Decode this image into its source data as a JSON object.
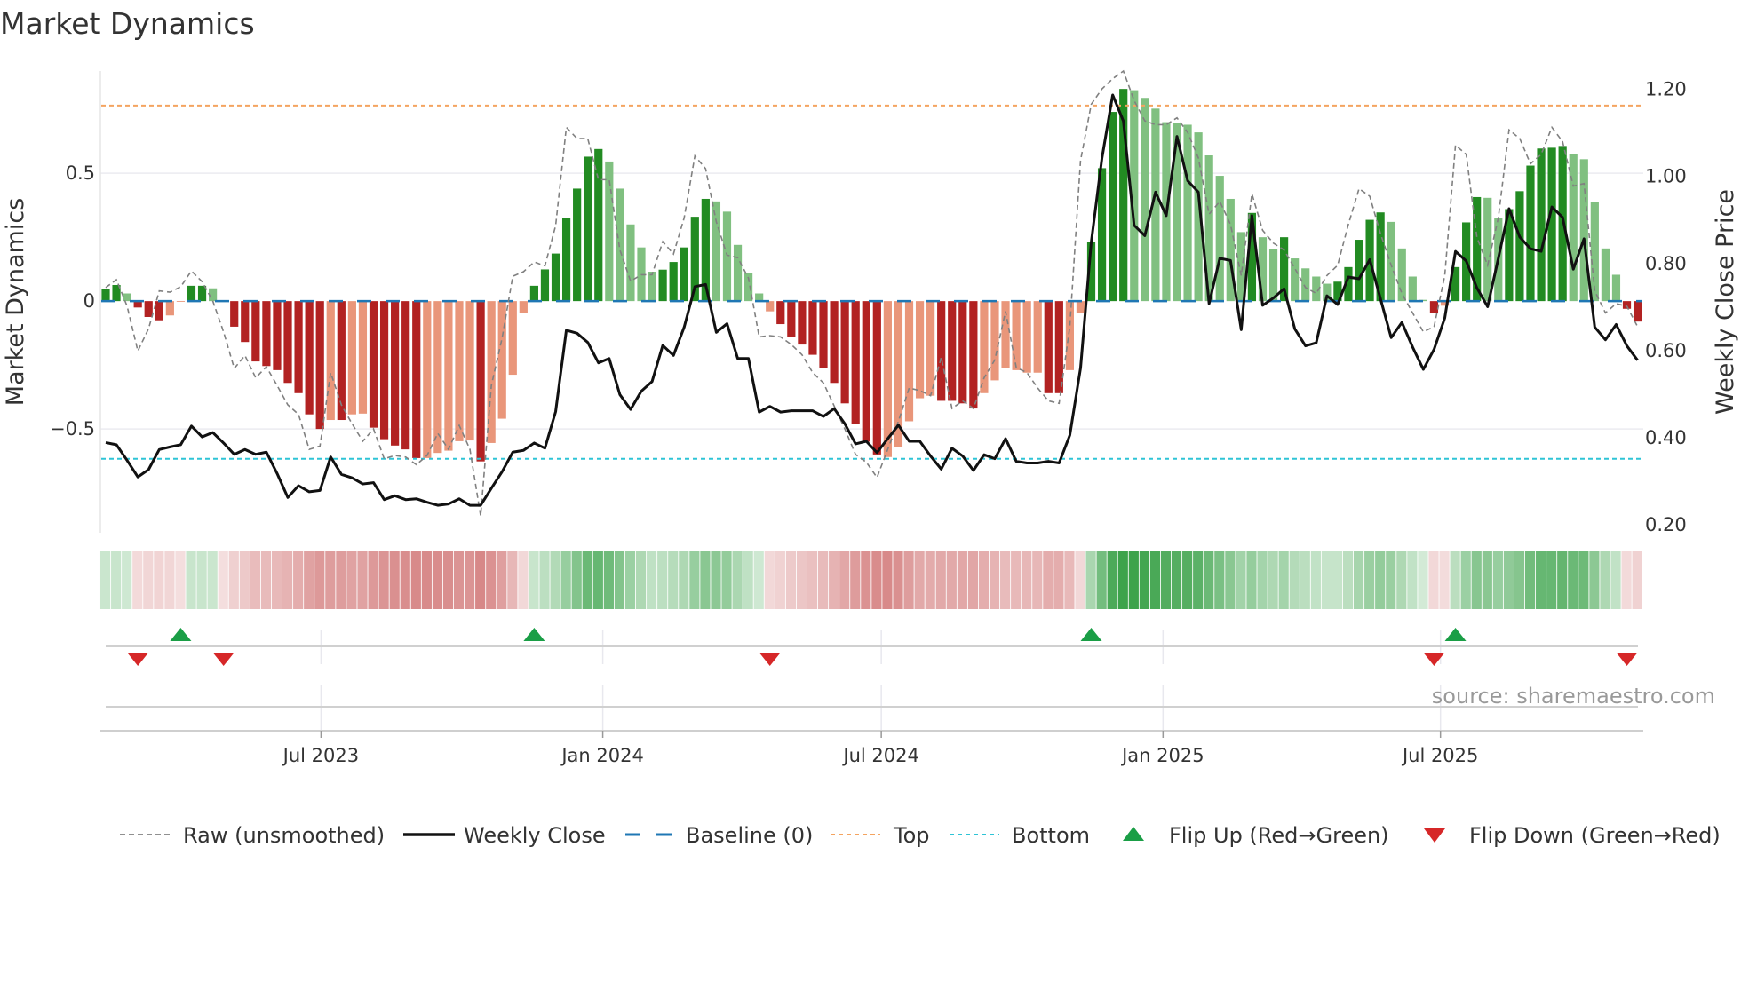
{
  "chart_data": {
    "type": "bar",
    "title": "Market Dynamics",
    "ylabel_left": "Market Dynamics",
    "ylabel_right": "Weekly Close Price",
    "source": "source: sharemaestro.com",
    "ylim_left": [
      -0.906,
      0.9
    ],
    "ylim_right": [
      0.18,
      1.24
    ],
    "left_ticks": [
      {
        "v": 0.5,
        "label": "0.5"
      },
      {
        "v": 0,
        "label": "0"
      },
      {
        "v": -0.5,
        "label": "−0.5"
      }
    ],
    "right_ticks": [
      {
        "v": 1.2,
        "label": "1.20"
      },
      {
        "v": 1.0,
        "label": "1.00"
      },
      {
        "v": 0.8,
        "label": "0.80"
      },
      {
        "v": 0.6,
        "label": "0.60"
      },
      {
        "v": 0.4,
        "label": "0.40"
      },
      {
        "v": 0.2,
        "label": "0.20"
      }
    ],
    "x_ticks": [
      {
        "week": 20.1,
        "label": "Jul 2023"
      },
      {
        "week": 46.4,
        "label": "Jan 2024"
      },
      {
        "week": 72.4,
        "label": "Jul 2024"
      },
      {
        "week": 98.7,
        "label": "Jan 2025"
      },
      {
        "week": 124.6,
        "label": "Jul 2025"
      }
    ],
    "top_level": 0.765,
    "bottom_level": -0.617,
    "baseline": 0,
    "momentum": [
      0.047,
      0.063,
      0.03,
      -0.025,
      -0.062,
      -0.075,
      -0.056,
      -0.003,
      0.06,
      0.06,
      0.05,
      -0.003,
      -0.1,
      -0.16,
      -0.236,
      -0.254,
      -0.27,
      -0.32,
      -0.36,
      -0.443,
      -0.5,
      -0.465,
      -0.465,
      -0.443,
      -0.44,
      -0.495,
      -0.54,
      -0.565,
      -0.58,
      -0.614,
      -0.614,
      -0.594,
      -0.585,
      -0.548,
      -0.545,
      -0.627,
      -0.555,
      -0.46,
      -0.288,
      -0.048,
      0.06,
      0.124,
      0.186,
      0.324,
      0.44,
      0.565,
      0.595,
      0.546,
      0.44,
      0.3,
      0.21,
      0.115,
      0.123,
      0.153,
      0.21,
      0.33,
      0.4,
      0.39,
      0.35,
      0.22,
      0.11,
      0.03,
      -0.04,
      -0.09,
      -0.14,
      -0.17,
      -0.21,
      -0.26,
      -0.32,
      -0.4,
      -0.48,
      -0.55,
      -0.6,
      -0.61,
      -0.57,
      -0.47,
      -0.38,
      -0.37,
      -0.39,
      -0.39,
      -0.4,
      -0.42,
      -0.36,
      -0.31,
      -0.26,
      -0.27,
      -0.28,
      -0.28,
      -0.36,
      -0.36,
      -0.27,
      -0.046,
      0.233,
      0.52,
      0.74,
      0.83,
      0.825,
      0.795,
      0.753,
      0.7,
      0.698,
      0.69,
      0.66,
      0.57,
      0.49,
      0.4,
      0.27,
      0.345,
      0.25,
      0.205,
      0.25,
      0.167,
      0.128,
      0.096,
      0.068,
      0.076,
      0.133,
      0.24,
      0.318,
      0.347,
      0.31,
      0.206,
      0.096,
      0.005,
      -0.048,
      -0.018,
      0.133,
      0.308,
      0.407,
      0.404,
      0.326,
      0.36,
      0.43,
      0.53,
      0.597,
      0.6,
      0.607,
      0.574,
      0.555,
      0.386,
      0.206,
      0.103,
      -0.03,
      -0.08
    ],
    "strong": [
      1,
      1,
      0,
      1,
      1,
      1,
      0,
      0,
      1,
      1,
      0,
      0,
      1,
      1,
      1,
      1,
      1,
      1,
      1,
      1,
      1,
      0,
      1,
      0,
      0,
      1,
      1,
      1,
      1,
      1,
      0,
      0,
      0,
      0,
      0,
      1,
      0,
      0,
      0,
      0,
      1,
      1,
      1,
      1,
      1,
      1,
      1,
      0,
      0,
      0,
      0,
      0,
      1,
      1,
      1,
      1,
      1,
      0,
      0,
      0,
      0,
      0,
      0,
      1,
      1,
      1,
      1,
      1,
      1,
      1,
      1,
      1,
      1,
      0,
      0,
      0,
      0,
      0,
      1,
      1,
      1,
      1,
      0,
      0,
      0,
      0,
      0,
      0,
      1,
      1,
      0,
      0,
      1,
      1,
      1,
      1,
      0,
      0,
      0,
      0,
      0,
      0,
      0,
      0,
      0,
      0,
      0,
      1,
      0,
      0,
      1,
      0,
      0,
      0,
      0,
      1,
      1,
      1,
      1,
      1,
      0,
      0,
      0,
      0,
      1,
      0,
      1,
      1,
      1,
      0,
      0,
      1,
      1,
      1,
      1,
      1,
      1,
      0,
      0,
      0,
      0,
      0,
      1,
      1
    ],
    "raw": [
      0.053,
      0.084,
      -0.02,
      -0.195,
      -0.108,
      0.04,
      0.035,
      0.056,
      0.118,
      0.076,
      0,
      -0.12,
      -0.263,
      -0.213,
      -0.3,
      -0.257,
      -0.33,
      -0.406,
      -0.443,
      -0.58,
      -0.567,
      -0.28,
      -0.406,
      -0.48,
      -0.548,
      -0.5,
      -0.617,
      -0.604,
      -0.61,
      -0.64,
      -0.604,
      -0.517,
      -0.58,
      -0.486,
      -0.58,
      -0.84,
      -0.33,
      -0.145,
      0.097,
      0.115,
      0.153,
      0.138,
      0.295,
      0.68,
      0.636,
      0.636,
      0.475,
      0.475,
      0.2,
      0.078,
      0.103,
      0.103,
      0.233,
      0.184,
      0.326,
      0.568,
      0.518,
      0.31,
      0.18,
      0.17,
      0.09,
      -0.14,
      -0.135,
      -0.14,
      -0.17,
      -0.21,
      -0.28,
      -0.32,
      -0.41,
      -0.5,
      -0.6,
      -0.63,
      -0.69,
      -0.58,
      -0.47,
      -0.34,
      -0.35,
      -0.37,
      -0.22,
      -0.42,
      -0.39,
      -0.42,
      -0.3,
      -0.23,
      -0.04,
      -0.26,
      -0.28,
      -0.34,
      -0.39,
      -0.4,
      -0.1,
      0.55,
      0.77,
      0.83,
      0.87,
      0.9,
      0.785,
      0.705,
      0.69,
      0.69,
      0.717,
      0.66,
      0.56,
      0.34,
      0.39,
      0.3,
      0.1,
      0.42,
      0.277,
      0.227,
      0.2,
      0.128,
      0.053,
      0.03,
      0.1,
      0.14,
      0.3,
      0.44,
      0.41,
      0.264,
      0.14,
      0.03,
      -0.046,
      -0.12,
      -0.1,
      0.1,
      0.61,
      0.574,
      0.25,
      0.14,
      0.326,
      0.67,
      0.636,
      0.537,
      0.574,
      0.68,
      0.624,
      0.45,
      0.46,
      0.04,
      -0.046,
      -0.01,
      -0.02,
      -0.1
    ],
    "close": [
      0.387,
      0.382,
      0.346,
      0.308,
      0.325,
      0.371,
      0.377,
      0.382,
      0.425,
      0.4,
      0.41,
      0.386,
      0.36,
      0.371,
      0.36,
      0.365,
      0.316,
      0.261,
      0.288,
      0.274,
      0.277,
      0.354,
      0.314,
      0.306,
      0.292,
      0.295,
      0.256,
      0.265,
      0.256,
      0.258,
      0.25,
      0.243,
      0.246,
      0.258,
      0.243,
      0.243,
      0.282,
      0.32,
      0.365,
      0.369,
      0.386,
      0.374,
      0.458,
      0.645,
      0.638,
      0.617,
      0.57,
      0.58,
      0.497,
      0.463,
      0.505,
      0.527,
      0.61,
      0.587,
      0.652,
      0.745,
      0.75,
      0.64,
      0.66,
      0.58,
      0.58,
      0.457,
      0.47,
      0.457,
      0.46,
      0.46,
      0.46,
      0.447,
      0.465,
      0.43,
      0.384,
      0.39,
      0.364,
      0.396,
      0.427,
      0.39,
      0.39,
      0.356,
      0.326,
      0.374,
      0.356,
      0.323,
      0.359,
      0.35,
      0.396,
      0.344,
      0.34,
      0.34,
      0.344,
      0.34,
      0.404,
      0.558,
      0.847,
      1.04,
      1.185,
      1.125,
      0.886,
      0.862,
      0.962,
      0.908,
      1.09,
      0.988,
      0.962,
      0.706,
      0.81,
      0.805,
      0.646,
      0.908,
      0.702,
      0.719,
      0.74,
      0.648,
      0.609,
      0.616,
      0.724,
      0.704,
      0.767,
      0.763,
      0.807,
      0.717,
      0.628,
      0.663,
      0.606,
      0.555,
      0.601,
      0.673,
      0.826,
      0.804,
      0.742,
      0.699,
      0.81,
      0.924,
      0.859,
      0.832,
      0.826,
      0.928,
      0.904,
      0.785,
      0.855,
      0.652,
      0.623,
      0.658,
      0.609,
      0.576
    ],
    "flip_up_weeks": [
      7,
      40,
      92,
      126
    ],
    "flip_down_weeks": [
      3,
      11,
      62,
      124,
      142
    ],
    "legend": [
      {
        "label": "Raw (unsmoothed)",
        "kind": "raw"
      },
      {
        "label": "Weekly Close",
        "kind": "close"
      },
      {
        "label": "Baseline (0)",
        "kind": "baseline"
      },
      {
        "label": "Top",
        "kind": "top"
      },
      {
        "label": "Bottom",
        "kind": "bottom"
      },
      {
        "label": "Flip Up (Red→Green)",
        "kind": "up"
      },
      {
        "label": "Flip Down (Green→Red)",
        "kind": "down"
      }
    ],
    "colors": {
      "green_strong": "#228b22",
      "green_weak": "#80c080",
      "red_strong": "#b22222",
      "red_weak": "#e9967a",
      "top": "#f4a460",
      "bottom": "#2ec4d6",
      "baseline": "#1f77b4",
      "raw": "#808080",
      "close": "#111111",
      "flip_up": "#1a9e46",
      "flip_down": "#d62728"
    }
  }
}
